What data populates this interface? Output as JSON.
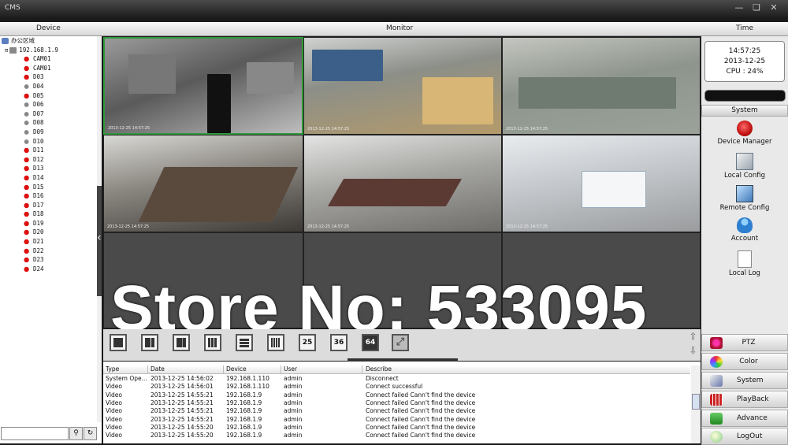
{
  "window": {
    "title": "CMS"
  },
  "headers": {
    "device": "Device",
    "monitor": "Monitor",
    "time": "Time"
  },
  "tree": {
    "root": "办公区域",
    "host": "192.168.1.9",
    "items": [
      "CAM01",
      "CAM01",
      "D03",
      "D04",
      "D05",
      "D06",
      "D07",
      "D08",
      "D09",
      "D10",
      "D11",
      "D12",
      "D13",
      "D14",
      "D15",
      "D16",
      "D17",
      "D18",
      "D19",
      "D20",
      "D21",
      "D22",
      "D23",
      "D24"
    ],
    "status": [
      "red",
      "red",
      "red",
      "grey",
      "red",
      "grey",
      "grey",
      "grey",
      "grey",
      "grey",
      "red",
      "red",
      "red",
      "red",
      "red",
      "red",
      "red",
      "red",
      "red",
      "red",
      "red",
      "red",
      "red",
      "red"
    ]
  },
  "camera_timestamp": "2013-12-25 14:57:25",
  "watermark": "Store No: 533095",
  "layout_buttons": [
    "",
    "",
    "",
    "",
    "",
    "",
    "25",
    "36",
    "64",
    ""
  ],
  "log": {
    "columns": [
      "Type",
      "Date",
      "Device",
      "User",
      "Describe"
    ],
    "rows": [
      [
        "System Ope...",
        "2013-12-25 14:56:02",
        "192.168.1.110",
        "admin",
        "Disconnect"
      ],
      [
        "Video",
        "2013-12-25 14:56:01",
        "192.168.1.110",
        "admin",
        "Connect successful"
      ],
      [
        "Video",
        "2013-12-25 14:55:21",
        "192.168.1.9",
        "admin",
        "Connect failed Cann't find the device"
      ],
      [
        "Video",
        "2013-12-25 14:55:21",
        "192.168.1.9",
        "admin",
        "Connect failed Cann't find the device"
      ],
      [
        "Video",
        "2013-12-25 14:55:21",
        "192.168.1.9",
        "admin",
        "Connect failed Cann't find the device"
      ],
      [
        "Video",
        "2013-12-25 14:55:21",
        "192.168.1.9",
        "admin",
        "Connect failed Cann't find the device"
      ],
      [
        "Video",
        "2013-12-25 14:55:20",
        "192.168.1.9",
        "admin",
        "Connect failed Cann't find the device"
      ],
      [
        "Video",
        "2013-12-25 14:55:20",
        "192.168.1.9",
        "admin",
        "Connect failed Cann't find the device"
      ]
    ]
  },
  "clock": {
    "time": "14:57:25",
    "date": "2013-12-25",
    "cpu": "CPU : 24%"
  },
  "system": {
    "tab": "System",
    "items": [
      "Device Manager",
      "Local Config",
      "Remote Config",
      "Account",
      "Local Log"
    ]
  },
  "nav": [
    "PTZ",
    "Color",
    "System",
    "PlayBack",
    "Advance",
    "LogOut"
  ],
  "colors": {
    "selected_border": "#2f9a3a",
    "alarm": "#d11111"
  }
}
